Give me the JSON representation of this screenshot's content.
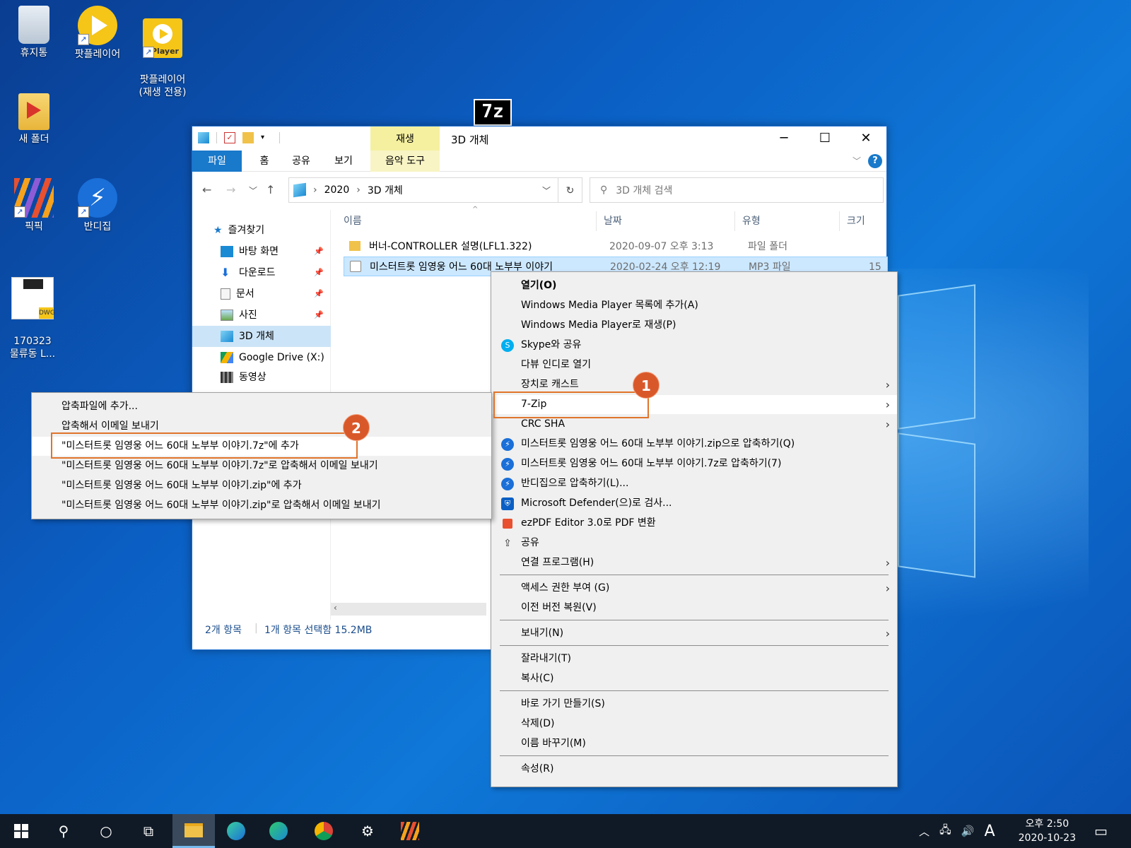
{
  "desktop": {
    "icons": [
      {
        "label": "휴지통",
        "icon": "recycle-bin-icon"
      },
      {
        "label": "팟플레이어",
        "icon": "potplayer-icon"
      },
      {
        "label": "팟플레이어\n(재생 전용)",
        "icon": "potplayer-playonly-icon",
        "badge": "Player"
      },
      {
        "label": "새 폴더",
        "icon": "folder-icon"
      },
      {
        "label": "픽픽",
        "icon": "picpick-icon"
      },
      {
        "label": "반디집",
        "icon": "bandizip-icon"
      },
      {
        "label": "170323\n물류동 L...",
        "icon": "dwg-file-icon",
        "badge": "DWG"
      }
    ],
    "floating_icon": {
      "text": "7z",
      "icon": "7z-icon"
    }
  },
  "explorer": {
    "title": "3D 개체",
    "context_tab_head": "재생",
    "ribbon_tabs": [
      "파일",
      "홈",
      "공유",
      "보기",
      "음악 도구"
    ],
    "address": {
      "segments": [
        "2020",
        "3D 개체"
      ]
    },
    "search_placeholder": "3D 개체 검색",
    "nav": {
      "favorites": "즐겨찾기",
      "items": [
        {
          "label": "바탕 화면",
          "pinned": true
        },
        {
          "label": "다운로드",
          "pinned": true
        },
        {
          "label": "문서",
          "pinned": true
        },
        {
          "label": "사진",
          "pinned": true
        },
        {
          "label": "3D 개체",
          "selected": true
        },
        {
          "label": "Google Drive (X:)"
        },
        {
          "label": "동영상"
        }
      ]
    },
    "columns": [
      "이름",
      "날짜",
      "유형",
      "크기"
    ],
    "files": [
      {
        "name": "버너-CONTROLLER 설명(LFL1.322)",
        "date": "2020-09-07 오후 3:13",
        "type": "파일 폴더",
        "size": ""
      },
      {
        "name": "미스터트롯 임영웅 어느 60대 노부부 이야기",
        "date": "2020-02-24 오후 12:19",
        "type": "MP3 파일",
        "size": "15"
      }
    ],
    "status": {
      "count": "2개 항목",
      "selection": "1개 항목 선택함 15.2MB"
    }
  },
  "context_menu": {
    "items": [
      {
        "label": "열기(O)",
        "bold": true
      },
      {
        "label": "Windows Media Player 목록에 추가(A)"
      },
      {
        "label": "Windows Media Player로 재생(P)"
      },
      {
        "label": "Skype와 공유",
        "icon": "skype-icon"
      },
      {
        "label": "다뷰 인디로 열기"
      },
      {
        "label": "장치로 캐스트",
        "submenu": true
      },
      {
        "label": "7-Zip",
        "submenu": true,
        "highlight": true
      },
      {
        "label": "CRC SHA",
        "submenu": true
      },
      {
        "label": "미스터트롯 임영웅 어느 60대 노부부 이야기.zip으로 압축하기(Q)",
        "icon": "bandizip-icon"
      },
      {
        "label": "미스터트롯 임영웅 어느 60대 노부부 이야기.7z로 압축하기(7)",
        "icon": "bandizip-icon"
      },
      {
        "label": "반디집으로 압축하기(L)...",
        "icon": "bandizip-icon"
      },
      {
        "label": "Microsoft Defender(으)로 검사...",
        "icon": "defender-icon"
      },
      {
        "label": "ezPDF Editor 3.0로 PDF 변환",
        "icon": "ezpdf-icon"
      },
      {
        "label": "공유",
        "icon": "share-icon"
      },
      {
        "label": "연결 프로그램(H)",
        "submenu": true
      },
      {
        "label": "액세스 권한 부여 (G)",
        "submenu": true
      },
      {
        "label": "이전 버전 복원(V)"
      },
      {
        "label": "보내기(N)",
        "submenu": true
      },
      {
        "label": "잘라내기(T)"
      },
      {
        "label": "복사(C)"
      },
      {
        "label": "바로 가기 만들기(S)"
      },
      {
        "label": "삭제(D)"
      },
      {
        "label": "이름 바꾸기(M)"
      },
      {
        "label": "속성(R)"
      }
    ]
  },
  "submenu_7zip": {
    "items": [
      {
        "label": "압축파일에 추가..."
      },
      {
        "label": "압축해서 이메일 보내기"
      },
      {
        "label": "\"미스터트롯 임영웅 어느 60대 노부부 이야기.7z\"에 추가",
        "highlight": true
      },
      {
        "label": "\"미스터트롯 임영웅 어느 60대 노부부 이야기.7z\"로 압축해서 이메일 보내기"
      },
      {
        "label": "\"미스터트롯 임영웅 어느 60대 노부부 이야기.zip\"에 추가"
      },
      {
        "label": "\"미스터트롯 임영웅 어느 60대 노부부 이야기.zip\"로 압축해서 이메일 보내기"
      }
    ]
  },
  "annotations": [
    "1",
    "2"
  ],
  "taskbar": {
    "apps": [
      "start-icon",
      "search-icon",
      "cortana-icon",
      "task-view-icon",
      "file-explorer-icon",
      "app-icon",
      "edge-icon",
      "chrome-icon",
      "settings-icon",
      "picpick-icon"
    ],
    "ime": "A",
    "time": "오후 2:50",
    "date": "2020-10-23"
  },
  "colors": {
    "accent": "#1979ca",
    "highlight": "#e0742a",
    "badge": "#d9582a"
  }
}
